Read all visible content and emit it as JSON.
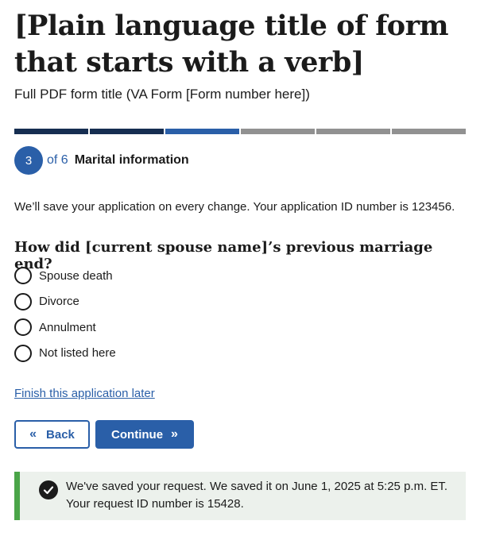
{
  "header": {
    "title": "[Plain language title of form that starts with a verb]",
    "subtitle": "Full PDF form title (VA Form [Form number here])"
  },
  "progress": {
    "total_segments": 6,
    "current_step": 3,
    "colors": {
      "complete": "#162e51",
      "current": "#2a5fa8",
      "incomplete": "#919191"
    }
  },
  "step": {
    "number": "3",
    "of_text": "of 6",
    "title": "Marital information"
  },
  "save_note": "We’ll save your application on every change. Your application ID number is 123456.",
  "question": {
    "text": "How did [current spouse name]’s previous marriage end?",
    "options": [
      {
        "label": "Spouse death"
      },
      {
        "label": "Divorce"
      },
      {
        "label": "Annulment"
      },
      {
        "label": "Not listed here"
      }
    ]
  },
  "links": {
    "finish_later": "Finish this application later"
  },
  "buttons": {
    "back": "Back",
    "continue": "Continue"
  },
  "alert": {
    "line1": "We've saved your request. We saved it on June 1, 2025 at 5:25 p.m. ET.",
    "line2": "Your request ID number is 15428.",
    "icon": "check-circle-icon",
    "accent_color": "#4aa548"
  },
  "colors": {
    "primary": "#2a5fa8",
    "text": "#1b1b1b",
    "success_bg": "#ecf1ec"
  }
}
